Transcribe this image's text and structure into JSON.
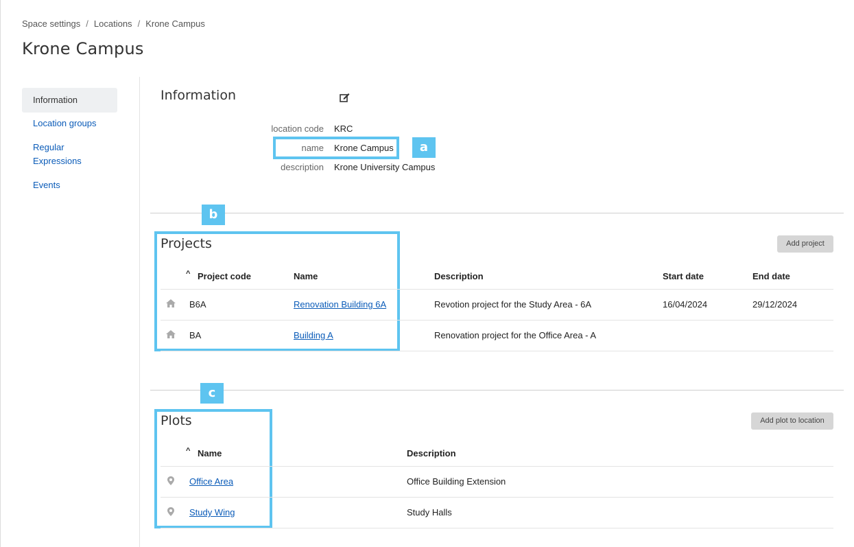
{
  "breadcrumb": [
    "Space settings",
    "Locations",
    "Krone Campus"
  ],
  "page_title": "Krone Campus",
  "nav": [
    {
      "label": "Information"
    },
    {
      "label": "Location groups"
    },
    {
      "label": "Regular"
    },
    {
      "label": "Expressions"
    },
    {
      "label": "Events"
    }
  ],
  "info": {
    "heading": "Information",
    "edit_icon": "edit-icon",
    "fields": [
      {
        "label": "location code",
        "value": "KRC"
      },
      {
        "label": "name",
        "value": "Krone Campus"
      },
      {
        "label": "description",
        "value": "Krone University Campus"
      }
    ]
  },
  "annotations": {
    "a": "a",
    "b": "b",
    "c": "c",
    "color": "#5ec4f0"
  },
  "projects": {
    "heading": "Projects",
    "add_button": "Add project",
    "columns": [
      "Project code",
      "Name",
      "Description",
      "Start date",
      "End date"
    ],
    "rows": [
      {
        "icon": "home-icon",
        "code": "B6A",
        "name": "Renovation Building 6A",
        "description": "Revotion project for the Study Area - 6A",
        "start": "16/04/2024",
        "end": "29/12/2024"
      },
      {
        "icon": "home-icon",
        "code": "BA",
        "name": "Building A",
        "description": "Renovation project for the Office Area - A",
        "start": "",
        "end": ""
      }
    ]
  },
  "plots": {
    "heading": "Plots",
    "add_button": "Add plot to location",
    "columns": [
      "Name",
      "Description"
    ],
    "rows": [
      {
        "icon": "map-pin-icon",
        "name": "Office Area",
        "description": "Office Building Extension"
      },
      {
        "icon": "map-pin-icon",
        "name": "Study Wing",
        "description": "Study Halls"
      }
    ]
  }
}
